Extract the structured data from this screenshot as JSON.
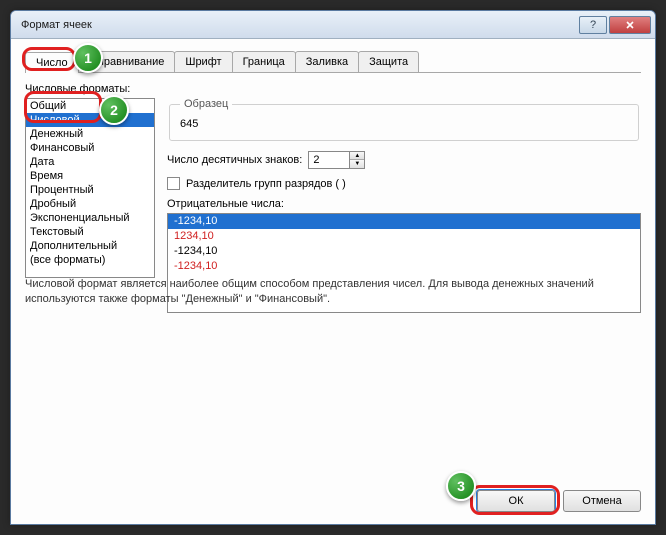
{
  "window": {
    "title": "Формат ячеек"
  },
  "tabs": [
    "Число",
    "Выравнивание",
    "Шрифт",
    "Граница",
    "Заливка",
    "Защита"
  ],
  "active_tab": 0,
  "labels": {
    "formats": "Числовые форматы:",
    "sample": "Образец",
    "decimals": "Число десятичных знаков:",
    "thousands": "Разделитель групп разрядов ( )",
    "negative": "Отрицательные числа:"
  },
  "format_list": [
    "Общий",
    "Числовой",
    "Денежный",
    "Финансовый",
    "Дата",
    "Время",
    "Процентный",
    "Дробный",
    "Экспоненциальный",
    "Текстовый",
    "Дополнительный",
    "(все форматы)"
  ],
  "selected_format_index": 1,
  "sample_value": "645",
  "decimals_value": "2",
  "thousands_checked": false,
  "negative_numbers": [
    {
      "text": "-1234,10",
      "color": "#ffffff",
      "bg": "#2070d0"
    },
    {
      "text": "1234,10",
      "color": "#d02020",
      "bg": ""
    },
    {
      "text": "-1234,10",
      "color": "#000000",
      "bg": ""
    },
    {
      "text": "-1234,10",
      "color": "#d02020",
      "bg": ""
    }
  ],
  "description": "Числовой формат является наиболее общим способом представления чисел. Для вывода денежных значений используются также форматы \"Денежный\" и \"Финансовый\".",
  "buttons": {
    "ok": "ОК",
    "cancel": "Отмена"
  },
  "markers": {
    "m1": "1",
    "m2": "2",
    "m3": "3"
  }
}
